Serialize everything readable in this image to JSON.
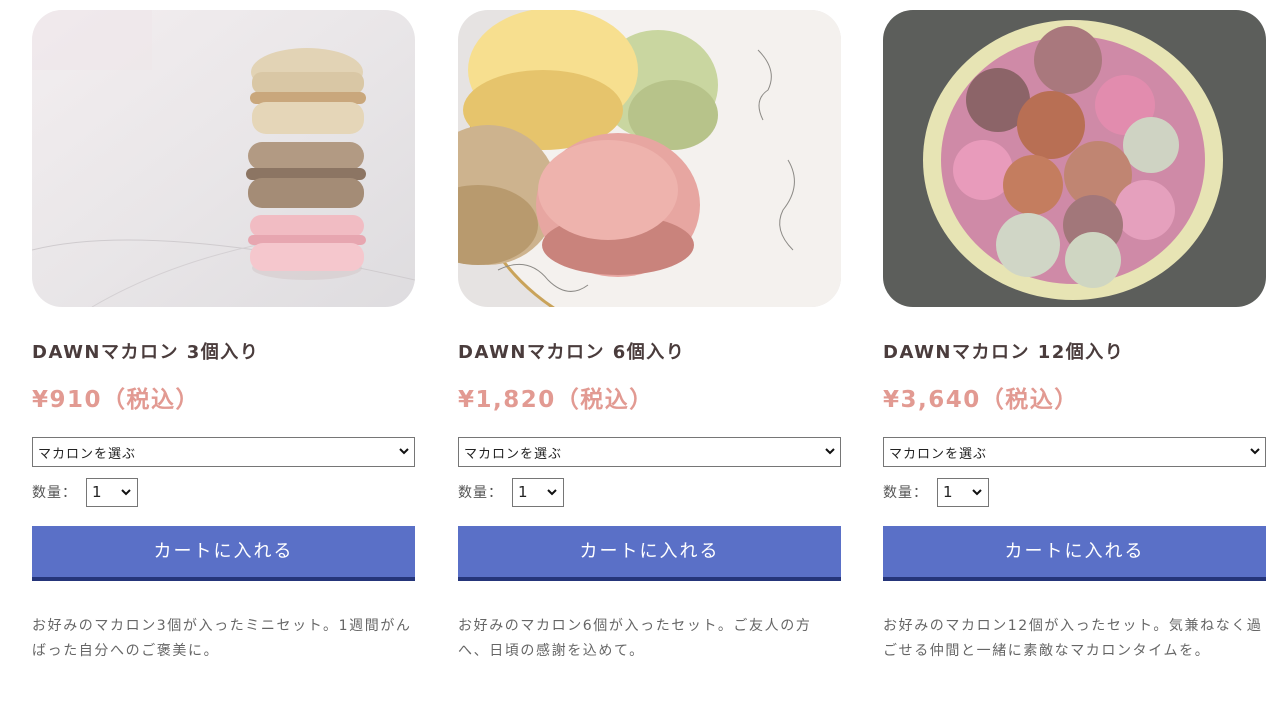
{
  "products": [
    {
      "name": "DAWNマカロン 3個入り",
      "price": "¥910（税込）",
      "select_label": "マカロンを選ぶ",
      "qty_label": "数量：",
      "qty_value": "1",
      "cart_label": "カートに入れる",
      "description": "お好みのマカロン3個が入ったミニセット。1週間がんばった自分へのご褒美に。",
      "image": "stacked-macarons-photo"
    },
    {
      "name": "DAWNマカロン 6個入り",
      "price": "¥1,820（税込）",
      "select_label": "マカロンを選ぶ",
      "qty_label": "数量：",
      "qty_value": "1",
      "cart_label": "カートに入れる",
      "description": "お好みのマカロン6個が入ったセット。ご友人の方へ、日頃の感謝を込めて。",
      "image": "macarons-on-plate-photo"
    },
    {
      "name": "DAWNマカロン 12個入り",
      "price": "¥3,640（税込）",
      "select_label": "マカロンを選ぶ",
      "qty_label": "数量：",
      "qty_value": "1",
      "cart_label": "カートに入れる",
      "description": "お好みのマカロン12個が入ったセット。気兼ねなく過ごせる仲間と一緒に素敵なマカロンタイムを。",
      "image": "macarons-in-bowl-photo"
    }
  ],
  "colors": {
    "name_text": "#4a3c3c",
    "price_text": "#e29a92",
    "button_bg": "#5a70c7",
    "button_border": "#25357a",
    "description_text": "#666666"
  }
}
